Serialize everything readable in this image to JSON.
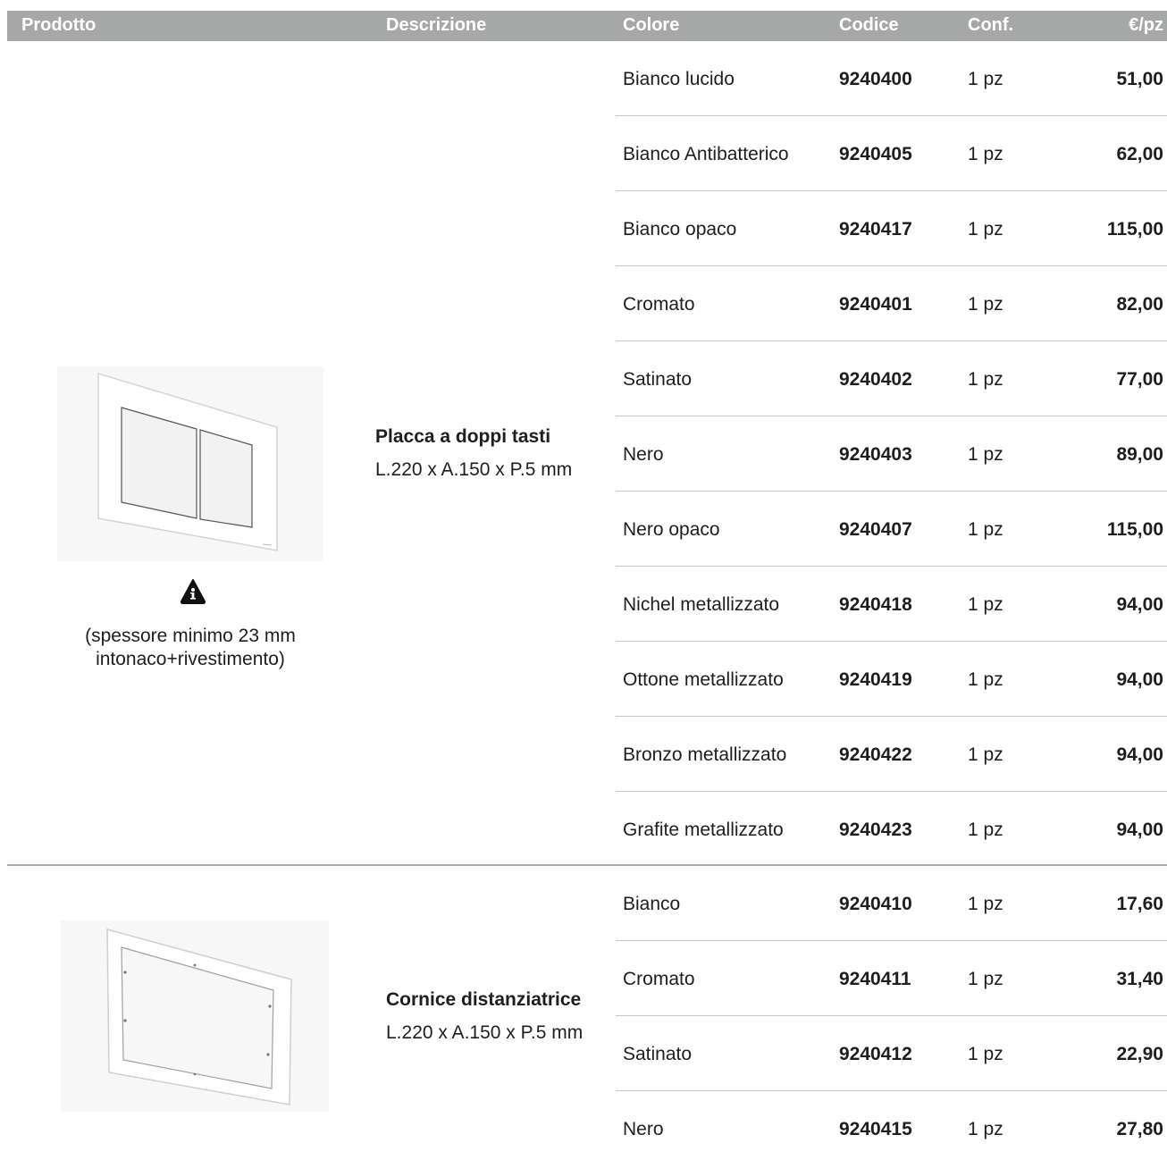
{
  "header": {
    "prodotto": "Prodotto",
    "descrizione": "Descrizione",
    "colore": "Colore",
    "codice": "Codice",
    "conf": "Conf.",
    "prezzo": "€/pz"
  },
  "products": [
    {
      "title": "Placca a doppi tasti",
      "dimensions": "L.220 x A.150 x P.5 mm",
      "image_icon": "flush-plate-image",
      "note_icon": "warning-icon",
      "note_line1": "(spessore minimo 23 mm",
      "note_line2": "intonaco+rivestimento)",
      "rows": [
        {
          "colore": "Bianco lucido",
          "codice": "9240400",
          "conf": "1 pz",
          "prezzo": "51,00"
        },
        {
          "colore": "Bianco Antibatterico",
          "codice": "9240405",
          "conf": "1 pz",
          "prezzo": "62,00"
        },
        {
          "colore": "Bianco opaco",
          "codice": "9240417",
          "conf": "1 pz",
          "prezzo": "115,00"
        },
        {
          "colore": "Cromato",
          "codice": "9240401",
          "conf": "1 pz",
          "prezzo": "82,00"
        },
        {
          "colore": "Satinato",
          "codice": "9240402",
          "conf": "1 pz",
          "prezzo": "77,00"
        },
        {
          "colore": "Nero",
          "codice": "9240403",
          "conf": "1 pz",
          "prezzo": "89,00"
        },
        {
          "colore": "Nero opaco",
          "codice": "9240407",
          "conf": "1 pz",
          "prezzo": "115,00"
        },
        {
          "colore": "Nichel metallizzato",
          "codice": "9240418",
          "conf": "1 pz",
          "prezzo": "94,00"
        },
        {
          "colore": "Ottone metallizzato",
          "codice": "9240419",
          "conf": "1 pz",
          "prezzo": "94,00"
        },
        {
          "colore": "Bronzo metallizzato",
          "codice": "9240422",
          "conf": "1 pz",
          "prezzo": "94,00"
        },
        {
          "colore": "Grafite metallizzato",
          "codice": "9240423",
          "conf": "1 pz",
          "prezzo": "94,00"
        }
      ]
    },
    {
      "title": "Cornice distanziatrice",
      "dimensions": "L.220 x A.150 x P.5 mm",
      "image_icon": "spacer-frame-image",
      "rows": [
        {
          "colore": "Bianco",
          "codice": "9240410",
          "conf": "1 pz",
          "prezzo": "17,60"
        },
        {
          "colore": "Cromato",
          "codice": "9240411",
          "conf": "1 pz",
          "prezzo": "31,40"
        },
        {
          "colore": "Satinato",
          "codice": "9240412",
          "conf": "1 pz",
          "prezzo": "22,90"
        },
        {
          "colore": "Nero",
          "codice": "9240415",
          "conf": "1 pz",
          "prezzo": "27,80"
        }
      ]
    }
  ],
  "colors": {
    "header_bg": "#a6a8a7",
    "header_text": "#ffffff",
    "row_separator": "#c8c8c8"
  }
}
